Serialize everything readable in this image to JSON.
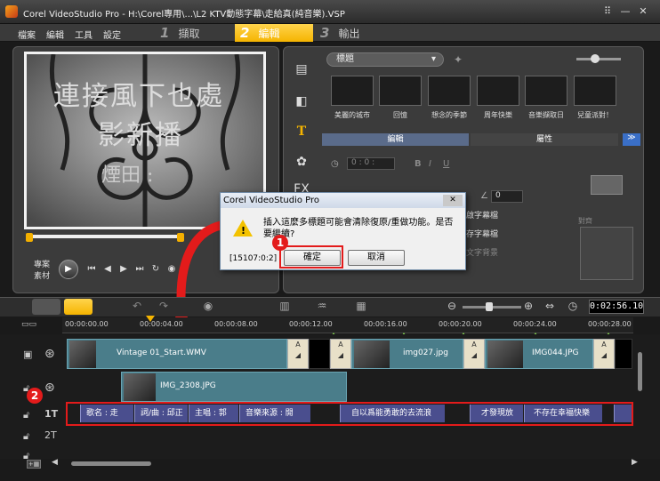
{
  "window": {
    "title": "Corel VideoStudio Pro - H:\\Corel專用\\...\\L2 KTV動態字幕\\走給真(純音樂).VSP"
  },
  "menu": {
    "items": [
      "檔案",
      "編輯",
      "工具",
      "設定"
    ]
  },
  "steps": [
    {
      "num": "1",
      "label": "擷取"
    },
    {
      "num": "2",
      "label": "編輯"
    },
    {
      "num": "3",
      "label": "輸出"
    }
  ],
  "preview": {
    "overlay_line1": "連接風下也處",
    "overlay_line2": "影新播",
    "overlay_line3": "煙田 :",
    "mode_project": "專案",
    "mode_clip": "素材"
  },
  "library": {
    "category": "標題",
    "thumbnails": [
      "美麗的城市",
      "回憶",
      "想念的季節",
      "周年快樂",
      "音樂擷取日",
      "兒童派對！"
    ],
    "tab_edit": "編輯",
    "tab_attr": "屬性",
    "font_size": "0",
    "opt_line1": "啟字幕檔",
    "opt_line2": "存字幕檔",
    "opt_line3": "文字背景",
    "align_label": "對齊"
  },
  "dialog": {
    "title": "Corel VideoStudio Pro",
    "message": "插入這麼多標題可能會清除復原/重做功能。是否要繼續?",
    "code": "[15107:0:2]",
    "ok_label": "確定",
    "cancel_label": "取消",
    "close_label": "✕"
  },
  "callouts": {
    "one": "1",
    "two": "2"
  },
  "timeline": {
    "timecode": "0:02:56.10",
    "ruler": [
      "00:00:00.00",
      "00:00:04.00",
      "00:00:08.00",
      "00:00:12.00",
      "00:00:16.00",
      "00:00:20.00",
      "00:00:24.00",
      "00:00:28.00"
    ],
    "video_clips": [
      "Vintage 01_Start.WMV",
      "img027.jpg",
      "IMG044.JPG"
    ],
    "overlay_clip": "IMG_2308.JPG",
    "title_clips": [
      "歌名 : 走",
      "詞/曲 : 邱正",
      "主唱 : 郭",
      "音樂來源 : 開",
      "自以爲能勇敢的去流浪",
      "才發現放",
      "不存在幸福快樂"
    ],
    "track_labels": {
      "title1": "1T",
      "title2": "2T"
    }
  }
}
